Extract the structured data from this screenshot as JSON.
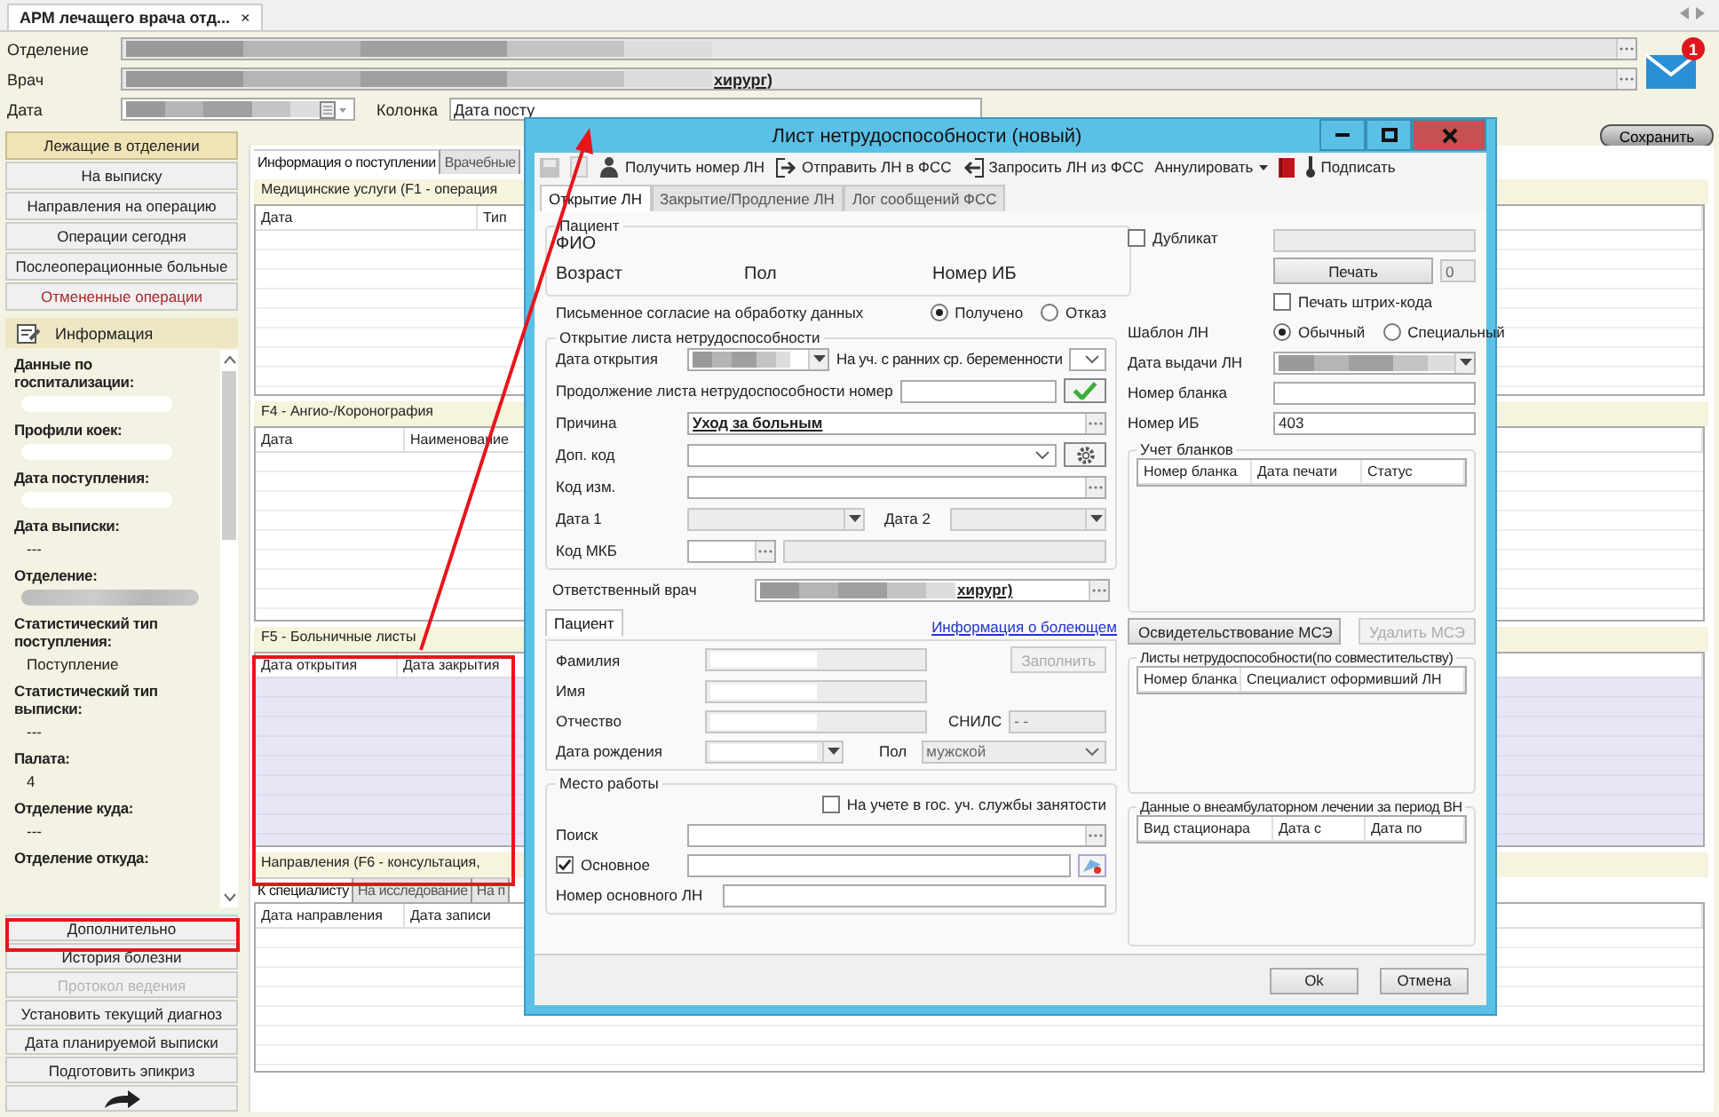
{
  "app_tab": {
    "title": "АРМ лечащего врача отд...",
    "close": "×"
  },
  "header": {
    "department": {
      "label": "Отделение",
      "field": {
        "blurred": true,
        "kind": "ellipsis"
      }
    },
    "doctor": {
      "label": "Врач",
      "field": {
        "blurred": true,
        "suffix": "хирург)",
        "kind": "ellipsis"
      }
    },
    "date": {
      "label": "Дата",
      "field": {
        "blurred": true,
        "kind": "calendar"
      }
    },
    "column": {
      "label": "Колонка",
      "field": {
        "value": "Дата посту"
      }
    },
    "mail": {
      "badge": "1"
    }
  },
  "nav": [
    {
      "label": "Лежащие в отделении",
      "selected": true,
      "alert": false
    },
    {
      "label": "На выписку",
      "selected": false,
      "alert": false
    },
    {
      "label": "Направления на операцию",
      "selected": false,
      "alert": false
    },
    {
      "label": "Операции сегодня",
      "selected": false,
      "alert": false
    },
    {
      "label": "Послеоперационные больные",
      "selected": false,
      "alert": false
    },
    {
      "label": "Отмененные операции",
      "selected": false,
      "alert": true
    }
  ],
  "info": {
    "title": "Информация",
    "entries": [
      {
        "label": "Данные по госпитализации:",
        "kind": "blank"
      },
      {
        "label": "Профили коек:",
        "kind": "blank"
      },
      {
        "label": "Дата поступления:",
        "kind": "blank"
      },
      {
        "label": "Дата выписки:",
        "kind": "text",
        "value": "---"
      },
      {
        "label": "Отделение:",
        "kind": "blurred"
      },
      {
        "label": "Статистический тип поступления:",
        "kind": "text",
        "value": "Поступление"
      },
      {
        "label": "Статистический тип выписки:",
        "kind": "text",
        "value": "---"
      },
      {
        "label": "Палата:",
        "kind": "text",
        "value": "4"
      },
      {
        "label": "Отделение куда:",
        "kind": "text",
        "value": "---"
      },
      {
        "label": "Отделение откуда:",
        "kind": "none"
      }
    ]
  },
  "actions": [
    {
      "kind": "text",
      "label": "Дополнительно",
      "disabled": false
    },
    {
      "kind": "text",
      "label": "История болезни",
      "disabled": false
    },
    {
      "kind": "text",
      "label": "Протокол ведения",
      "disabled": true
    },
    {
      "kind": "text",
      "label": "Установить текущий диагноз",
      "disabled": false
    },
    {
      "kind": "text",
      "label": "Дата планируемой выписки",
      "disabled": false
    },
    {
      "kind": "text",
      "label": "Подготовить эпикриз",
      "disabled": false
    },
    {
      "kind": "arrow",
      "disabled": false
    }
  ],
  "main": {
    "save": "Сохранить",
    "tabs": [
      {
        "label": "Информация о поступлении",
        "selected": true
      },
      {
        "label": "Врачебные",
        "selected": false
      }
    ],
    "sections": [
      {
        "kind": "services",
        "title": "Медицинские услуги (F1 - операция",
        "columns": [
          "Дата",
          "Тип"
        ]
      },
      {
        "kind": "angio",
        "title": "F4 - Ангио-/Коронография",
        "columns": [
          "Дата",
          "Наименование"
        ]
      },
      {
        "kind": "sick",
        "title": "F5 - Больничные листы",
        "columns": [
          "Дата открытия",
          "Дата закрытия"
        ]
      },
      {
        "kind": "referrals",
        "title": "Направления (F6 - консультация,",
        "tabs": [
          {
            "label": "К специалисту",
            "selected": true
          },
          {
            "label": "На исследование",
            "selected": false
          },
          {
            "label": "На п",
            "selected": false
          }
        ],
        "columns": [
          "Дата направления",
          "Дата записи"
        ]
      }
    ]
  },
  "dialog": {
    "title": "Лист нетрудоспособности (новый)",
    "toolbar": [
      {
        "kind": "save",
        "disabled": true
      },
      {
        "kind": "doc",
        "disabled": true
      },
      {
        "kind": "user",
        "label": "Получить номер ЛН",
        "disabled": false
      },
      {
        "kind": "export",
        "label": "Отправить ЛН в ФСС",
        "disabled": false
      },
      {
        "kind": "import",
        "label": "Запросить ЛН из ФСС",
        "disabled": false
      },
      {
        "kind": "menu",
        "label": "Аннулировать",
        "disabled": false
      },
      {
        "kind": "book",
        "disabled": false
      },
      {
        "kind": "pen",
        "label": "Подписать",
        "disabled": false
      }
    ],
    "tabs": [
      {
        "label": "Открытие ЛН",
        "selected": true
      },
      {
        "label": "Закрытие/Продление ЛН",
        "selected": false
      },
      {
        "label": "Лог сообщений ФСС",
        "selected": false
      }
    ],
    "patient": {
      "legend": "Пациент",
      "fio": "ФИО",
      "age": "Возраст",
      "sex": "Пол",
      "ib": "Номер ИБ"
    },
    "consent": {
      "label": "Письменное согласие на обработку данных",
      "options": [
        {
          "label": "Получено",
          "selected": true
        },
        {
          "label": "Отказ",
          "selected": false
        }
      ]
    },
    "opening": {
      "legend": "Открытие листа нетрудоспособности",
      "date": {
        "label": "Дата открытия",
        "field": {
          "blurred": true,
          "kind": "dropdown"
        }
      },
      "pregnancy": {
        "label": "На уч. с ранних ср. беременности",
        "field": {
          "kind": "chevron"
        }
      },
      "continue": {
        "label": "Продолжение листа нетрудоспособности номер"
      },
      "reason": {
        "label": "Причина",
        "field": {
          "value": "Уход за больным",
          "kind": "ellipsis"
        }
      },
      "extra": {
        "label": "Доп. код",
        "field": {
          "kind": "chevron"
        }
      },
      "change": {
        "label": "Код изм.",
        "field": {
          "kind": "ellipsis"
        }
      },
      "date1": {
        "label": "Дата 1",
        "field": {
          "disabled": true,
          "kind": "dropdown"
        }
      },
      "date2": {
        "label": "Дата 2",
        "field": {
          "disabled": true,
          "kind": "dropdown"
        }
      },
      "mkb": {
        "label": "Код МКБ",
        "field": {
          "kind": "ellipsis"
        },
        "name": {
          "disabled": true
        }
      }
    },
    "doctor": {
      "label": "Ответственный врач",
      "field": {
        "blurred": true,
        "suffix": "хирург)",
        "kind": "ellipsis"
      }
    },
    "person": {
      "tab": "Пациент",
      "link": "Информация о болеющем",
      "fill": "Заполнить",
      "surname": {
        "label": "Фамилия",
        "field": {
          "blurred": true,
          "disabled": true
        }
      },
      "name": {
        "label": "Имя",
        "field": {
          "blurred": true,
          "disabled": true
        }
      },
      "patronymic": {
        "label": "Отчество",
        "field": {
          "blurred": true,
          "disabled": true
        }
      },
      "snils": {
        "label": "СНИЛС",
        "field": {
          "value": " -  -",
          "disabled": true
        }
      },
      "birth": {
        "label": "Дата рождения",
        "field": {
          "blurred": true,
          "disabled": true,
          "kind": "dropdown"
        }
      },
      "sex": {
        "label": "Пол",
        "field": {
          "value": "мужской",
          "disabled": true,
          "kind": "chevron"
        }
      }
    },
    "work": {
      "legend": "Место работы",
      "employment": {
        "label": "На учете в гос. уч. службы занятости",
        "checked": false
      },
      "search": {
        "label": "Поиск",
        "field": {
          "kind": "ellipsis"
        }
      },
      "main": {
        "label": "Основное",
        "checked": true
      },
      "number": {
        "label": "Номер основного ЛН"
      }
    },
    "duplicate": {
      "label": "Дубликат",
      "checked": false,
      "field": {
        "disabled": true
      }
    },
    "print": {
      "label": "Печать",
      "count": {
        "value": "0",
        "disabled": true
      }
    },
    "barcode": {
      "label": "Печать штрих-кода",
      "checked": false
    },
    "template": {
      "label": "Шаблон ЛН",
      "options": [
        {
          "label": "Обычный",
          "selected": true
        },
        {
          "label": "Специальный",
          "selected": false
        }
      ]
    },
    "issue_date": {
      "label": "Дата выдачи ЛН",
      "field": {
        "blurred": true,
        "kind": "dropdown"
      }
    },
    "blank": {
      "label": "Номер бланка"
    },
    "ib": {
      "label": "Номер ИБ",
      "field": {
        "value": "403"
      }
    },
    "forms": {
      "legend": "Учет бланков",
      "columns": [
        "Номер бланка",
        "Дата печати",
        "Статус"
      ]
    },
    "mse": {
      "exam": "Освидетельствование МСЭ",
      "remove": "Удалить МСЭ",
      "remove_disabled": true
    },
    "parttime": {
      "legend": "Листы нетрудоспособности(по совместительству)",
      "columns": [
        "Номер бланка",
        "Специалист оформивший ЛН"
      ]
    },
    "outpatient": {
      "legend": "Данные о внеамбулаторном лечении за период ВН",
      "columns": [
        "Вид стационара",
        "Дата с",
        "Дата по"
      ]
    },
    "ok": "Ok",
    "cancel": "Отмена"
  }
}
